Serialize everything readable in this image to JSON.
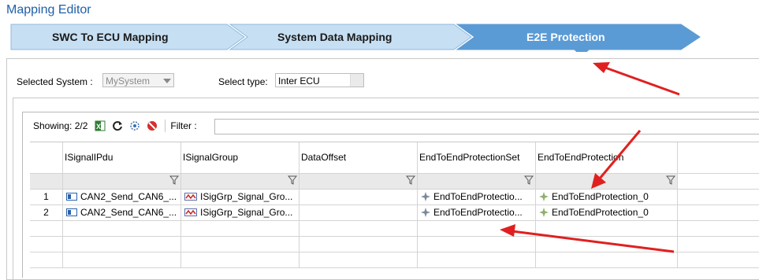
{
  "window": {
    "title": "Mapping Editor"
  },
  "wizard": {
    "steps": [
      {
        "label": "SWC To ECU Mapping",
        "active": false
      },
      {
        "label": "System Data Mapping",
        "active": false
      },
      {
        "label": "E2E Protection",
        "active": true
      }
    ],
    "active_color": "#5b9bd5",
    "inactive_color": "#c7dff3"
  },
  "selection": {
    "system_label": "Selected System :",
    "system_value": "MySystem",
    "type_label": "Select type:",
    "type_value": "Inter ECU"
  },
  "toolbar": {
    "showing": "Showing: 2/2",
    "icons": [
      "excel-export-icon",
      "refresh-icon",
      "settings-icon",
      "clear-filter-icon"
    ],
    "filter_label": "Filter :",
    "filter_value": ""
  },
  "table": {
    "columns": [
      "",
      "ISignalIPdu",
      "ISignalGroup",
      "DataOffset",
      "EndToEndProtectionSet",
      "EndToEndProtection"
    ],
    "rows": [
      {
        "num": "1",
        "pdu": "CAN2_Send_CAN6_...",
        "group": "ISigGrp_Signal_Gro...",
        "offset": "",
        "set": "EndToEndProtectio...",
        "prot": "EndToEndProtection_0"
      },
      {
        "num": "2",
        "pdu": "CAN2_Send_CAN6_...",
        "group": "ISigGrp_Signal_Gro...",
        "offset": "",
        "set": "EndToEndProtectio...",
        "prot": "EndToEndProtection_0"
      }
    ]
  },
  "annotation_color": "#e02020"
}
